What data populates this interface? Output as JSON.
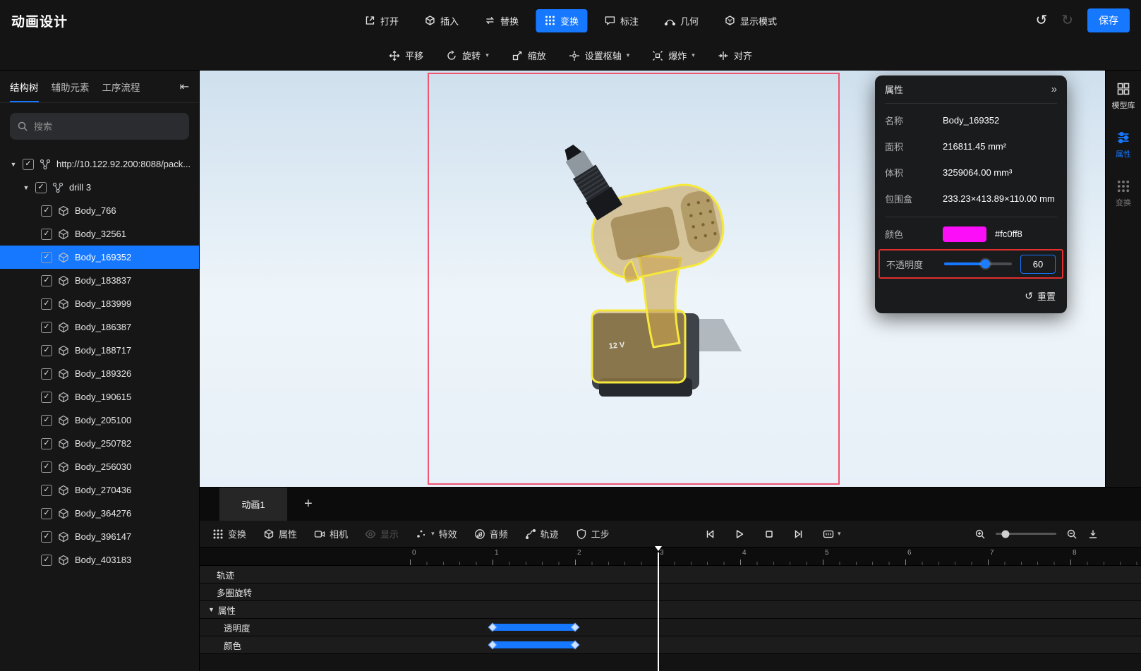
{
  "header": {
    "title": "动画设计",
    "tools": [
      {
        "label": "打开"
      },
      {
        "label": "插入"
      },
      {
        "label": "替换"
      },
      {
        "label": "变换",
        "active": true
      },
      {
        "label": "标注"
      },
      {
        "label": "几何"
      },
      {
        "label": "显示模式"
      }
    ],
    "save_label": "保存"
  },
  "subtoolbar": {
    "items": [
      {
        "label": "平移",
        "dropdown": false
      },
      {
        "label": "旋转",
        "dropdown": true
      },
      {
        "label": "缩放",
        "dropdown": false
      },
      {
        "label": "设置枢轴",
        "dropdown": true
      },
      {
        "label": "爆炸",
        "dropdown": true
      },
      {
        "label": "对齐",
        "dropdown": false
      }
    ]
  },
  "sidebar": {
    "tabs": [
      {
        "label": "结构树",
        "active": true
      },
      {
        "label": "辅助元素",
        "active": false
      },
      {
        "label": "工序流程",
        "active": false
      }
    ],
    "search_placeholder": "搜索",
    "tree": {
      "root_label": "http://10.122.92.200:8088/pack...",
      "group_label": "drill 3",
      "items": [
        "Body_766",
        "Body_32561",
        "Body_169352",
        "Body_183837",
        "Body_183999",
        "Body_186387",
        "Body_188717",
        "Body_189326",
        "Body_190615",
        "Body_205100",
        "Body_250782",
        "Body_256030",
        "Body_270436",
        "Body_364276",
        "Body_396147",
        "Body_403183"
      ],
      "selected_item": "Body_169352"
    }
  },
  "viewport": {
    "battery_label": "12 V"
  },
  "properties": {
    "title": "属性",
    "fields": [
      {
        "label": "名称",
        "value": "Body_169352"
      },
      {
        "label": "面积",
        "value": "216811.45 mm²"
      },
      {
        "label": "体积",
        "value": "3259064.00 mm³"
      },
      {
        "label": "包围盒",
        "value": "233.23×413.89×110.00 mm"
      }
    ],
    "color": {
      "label": "颜色",
      "hex": "#fc0ff8"
    },
    "opacity": {
      "label": "不透明度",
      "value": "60",
      "percent": 60
    },
    "reset_label": "重置"
  },
  "right_rail": {
    "items": [
      {
        "label": "模型库",
        "active": false
      },
      {
        "label": "属性",
        "active": true
      },
      {
        "label": "变换",
        "active": false
      }
    ]
  },
  "timeline": {
    "tab_label": "动画1",
    "tools": [
      {
        "label": "变换"
      },
      {
        "label": "属性"
      },
      {
        "label": "相机"
      },
      {
        "label": "显示",
        "disabled": true
      },
      {
        "label": "特效",
        "dropdown": true
      },
      {
        "label": "音频"
      },
      {
        "label": "轨迹"
      },
      {
        "label": "工步"
      }
    ],
    "ruler_labels": [
      "0",
      "1",
      "2",
      "3",
      "4",
      "5",
      "6",
      "7",
      "8"
    ],
    "playhead_time": 3,
    "rows": [
      {
        "label": "轨迹",
        "indent": 0
      },
      {
        "label": "多圈旋转",
        "indent": 0
      },
      {
        "label": "属性",
        "indent": 0,
        "expanded": true
      },
      {
        "label": "透明度",
        "indent": 1,
        "keyframes": [
          1,
          2
        ]
      },
      {
        "label": "颜色",
        "indent": 1,
        "keyframes": [
          1,
          2
        ]
      }
    ]
  },
  "colors": {
    "accent": "#1677ff",
    "selection_outline": "#f6e93c",
    "capture_border": "#ee5570",
    "highlight_border": "#e23030"
  }
}
